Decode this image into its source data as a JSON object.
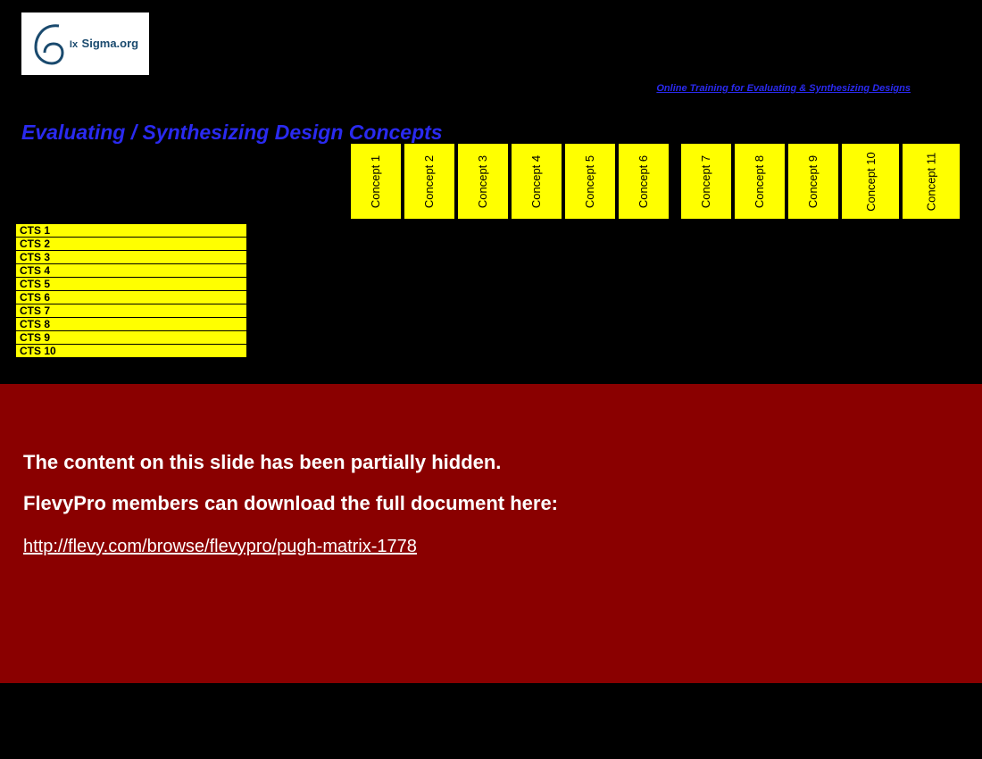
{
  "logo": {
    "ix": "Ix",
    "brand": "Sigma.org"
  },
  "training_link": "Online Training for Evaluating & Synthesizing Designs",
  "title": "Evaluating / Synthesizing Design Concepts",
  "concepts": [
    "Concept 1",
    "Concept 2",
    "Concept 3",
    "Concept 4",
    "Concept 5",
    "Concept 6",
    "Concept 7",
    "Concept 8",
    "Concept 9",
    "Concept 10",
    "Concept 11"
  ],
  "cts": [
    "CTS 1",
    "CTS 2",
    "CTS 3",
    "CTS 4",
    "CTS 5",
    "CTS 6",
    "CTS 7",
    "CTS 8",
    "CTS 9",
    "CTS 10"
  ],
  "overlay": {
    "line1": "The content on this slide has been partially hidden.",
    "line2": "FlevyPro members can download the full document here:",
    "url": "http://flevy.com/browse/flevypro/pugh-matrix-1778"
  }
}
